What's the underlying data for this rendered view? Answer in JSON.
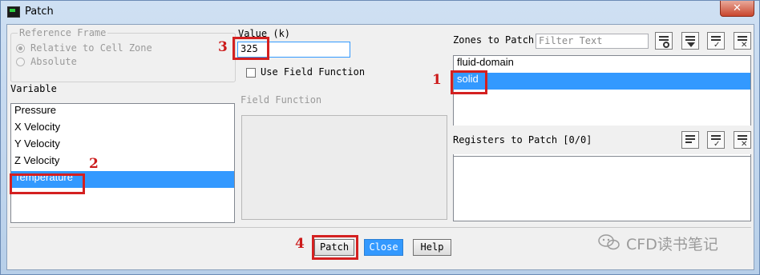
{
  "window": {
    "title": "Patch",
    "close_glyph": "✕"
  },
  "reference_frame": {
    "label": "Reference Frame",
    "options": [
      "Relative to Cell Zone",
      "Absolute"
    ],
    "selected": "Relative to Cell Zone"
  },
  "variable": {
    "label": "Variable",
    "items": [
      "Pressure",
      "X Velocity",
      "Y Velocity",
      "Z Velocity",
      "Temperature"
    ],
    "selected": "Temperature"
  },
  "value": {
    "label": "Value (k)",
    "current": "325"
  },
  "use_field_function": {
    "label": "Use Field Function",
    "checked": false
  },
  "field_function": {
    "label": "Field Function"
  },
  "zones": {
    "label": "Zones to Patch",
    "filter_placeholder": "Filter Text",
    "items": [
      "fluid-domain",
      "solid"
    ],
    "selected": "solid"
  },
  "registers": {
    "label": "Registers to Patch [0/0]"
  },
  "buttons": {
    "patch": "Patch",
    "close": "Close",
    "help": "Help"
  },
  "annotations": [
    "1",
    "2",
    "3",
    "4"
  ],
  "watermark": "CFD读书笔记",
  "colors": {
    "selection": "#3399ff",
    "annotation": "#d42020"
  }
}
